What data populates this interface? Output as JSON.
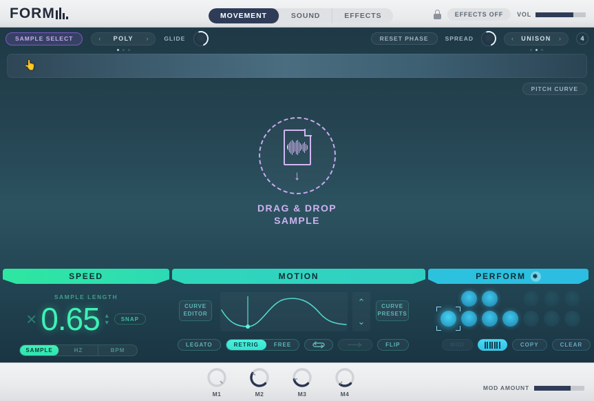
{
  "app": {
    "logo": "FORM"
  },
  "header": {
    "tabs": [
      {
        "label": "MOVEMENT",
        "active": true
      },
      {
        "label": "SOUND",
        "active": false
      },
      {
        "label": "EFFECTS",
        "active": false
      }
    ],
    "lock_icon": "lock-icon",
    "effects_toggle": "EFFECTS OFF",
    "volume": {
      "label": "VOL",
      "percent": 75
    }
  },
  "subbar": {
    "sample_select": "SAMPLE SELECT",
    "voice_mode": {
      "label": "POLY",
      "prev": "‹",
      "next": "›",
      "page_count": 3,
      "page_active": 0
    },
    "glide": {
      "label": "GLIDE"
    },
    "reset_phase": "RESET PHASE",
    "spread": {
      "label": "SPREAD"
    },
    "unison": {
      "label": "UNISON",
      "prev": "‹",
      "next": "›",
      "value": "4",
      "page_count": 3,
      "page_active": 1
    }
  },
  "wavestrip": {
    "cursor_icon": "hand-cursor"
  },
  "pitch_curve": "PITCH CURVE",
  "dropzone": {
    "icon": "audio-file-icon",
    "arrow_icon": "down-arrow-icon",
    "line1": "DRAG & DROP",
    "line2": "SAMPLE"
  },
  "sections": [
    {
      "label": "SPEED",
      "key": "speed"
    },
    {
      "label": "MOTION",
      "key": "motion"
    },
    {
      "label": "PERFORM",
      "key": "perform",
      "icon": "wand-icon"
    }
  ],
  "speed_panel": {
    "sample_length_label": "SAMPLE LENGTH",
    "multiplier_symbol": "×",
    "value": "0.65",
    "spinner_up": "▲",
    "spinner_down": "▼",
    "snap": "SNAP",
    "units": [
      {
        "label": "SAMPLE",
        "active": true
      },
      {
        "label": "HZ",
        "active": false
      },
      {
        "label": "BPM",
        "active": false
      }
    ]
  },
  "motion_panel": {
    "curve_editor_l1": "CURVE",
    "curve_editor_l2": "EDITOR",
    "curve_presets_l1": "CURVE",
    "curve_presets_l2": "PRESETS",
    "nudge_up": "⌃",
    "nudge_down": "⌄",
    "buttons": [
      {
        "label": "LEGATO",
        "state": "off"
      },
      {
        "label": "RETRIG",
        "state": "on"
      },
      {
        "label": "FREE",
        "state": "off"
      },
      {
        "label": "loop-icon",
        "state": "off",
        "icon": true
      },
      {
        "label": "arrow-right-icon",
        "state": "dim",
        "icon": true
      },
      {
        "label": "FLIP",
        "state": "off"
      }
    ]
  },
  "perform_panel": {
    "pads_row1": [
      "on",
      "on",
      "gap",
      "dim",
      "dim",
      "dim"
    ],
    "pads_row2": [
      "selected",
      "on",
      "on",
      "on",
      "dim",
      "dim",
      "dim"
    ],
    "buttons": [
      {
        "label": "MIDI",
        "state": "dim"
      },
      {
        "label": "keyboard-icon",
        "state": "on",
        "icon": true
      },
      {
        "label": "COPY",
        "state": "off"
      },
      {
        "label": "CLEAR",
        "state": "off"
      }
    ]
  },
  "footer": {
    "mod_knobs": [
      {
        "label": "M1",
        "percent": 0
      },
      {
        "label": "M2",
        "percent": 62
      },
      {
        "label": "M3",
        "percent": 45
      },
      {
        "label": "M4",
        "percent": 30
      }
    ],
    "mod_amount": {
      "label": "MOD AMOUNT",
      "percent": 72
    }
  },
  "colors": {
    "accent_green": "#3ef2b5",
    "accent_teal": "#35e2d0",
    "accent_cyan": "#2bbde2",
    "accent_purple": "#c8abf0",
    "navy": "#2e3c58"
  }
}
